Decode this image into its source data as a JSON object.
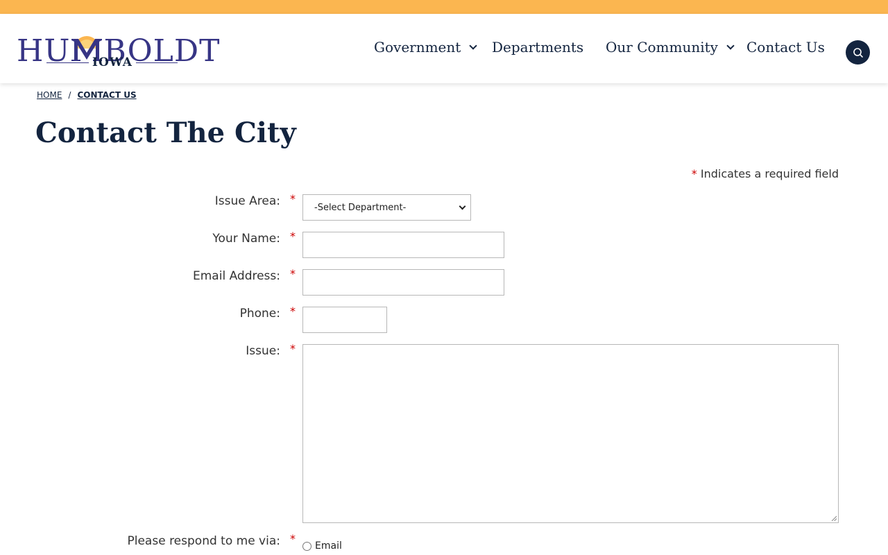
{
  "logo": {
    "name_left": "HU",
    "name_right": "BOLDT",
    "sub": "IOWA",
    "colors": {
      "primary": "#373585",
      "sun": "#fbb650"
    }
  },
  "nav": {
    "items": [
      {
        "label": "Government",
        "has_dropdown": true
      },
      {
        "label": "Departments",
        "has_dropdown": false
      },
      {
        "label": "Our Community",
        "has_dropdown": true
      },
      {
        "label": "Contact Us",
        "has_dropdown": false
      }
    ],
    "search_icon": "search-icon"
  },
  "breadcrumb": {
    "home": "HOME",
    "separator": "/",
    "current": "CONTACT US"
  },
  "page": {
    "title": "Contact The City"
  },
  "form": {
    "required_star": "*",
    "required_note": "Indicates a required field",
    "issue_area": {
      "label": "Issue Area:",
      "selected": "-Select Department-"
    },
    "name": {
      "label": "Your Name:",
      "value": ""
    },
    "email": {
      "label": "Email Address:",
      "value": ""
    },
    "phone": {
      "label": "Phone:",
      "value": ""
    },
    "issue": {
      "label": "Issue:",
      "value": ""
    },
    "respond": {
      "label": "Please respond to me via:",
      "options": [
        "Email"
      ]
    }
  },
  "colors": {
    "topbar": "#fbb650",
    "navy": "#13243f",
    "required": "#cc0000"
  }
}
